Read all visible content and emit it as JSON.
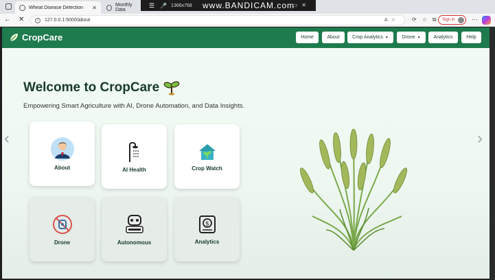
{
  "browser": {
    "tabs": [
      {
        "title": "Wheat Disease Detection",
        "active": true
      },
      {
        "title": "Monthly Data",
        "active": false
      }
    ],
    "recorder": {
      "resolution": "1366x768",
      "brand": "www.BANDICAM.com"
    },
    "url": "127.0.0.1:5000/about",
    "signin_label": "Sign in"
  },
  "navbar": {
    "brand": "CropCare",
    "items": [
      {
        "label": "Home",
        "dropdown": false
      },
      {
        "label": "About",
        "dropdown": false
      },
      {
        "label": "Crop Analytics",
        "dropdown": true
      },
      {
        "label": "Drone",
        "dropdown": true
      },
      {
        "label": "Analytics",
        "dropdown": false
      },
      {
        "label": "Help",
        "dropdown": false
      }
    ]
  },
  "hero": {
    "title": "Welcome to CropCare",
    "subtitle": "Empowering Smart Agriculture with AI, Drone Automation, and Data Insights."
  },
  "cards": [
    {
      "label": "About",
      "icon": "person-icon"
    },
    {
      "label": "AI Health",
      "icon": "shower-icon"
    },
    {
      "label": "Crop Watch",
      "icon": "house-leaf-icon"
    },
    {
      "label": "Drone",
      "icon": "drone-icon"
    },
    {
      "label": "Autonomous",
      "icon": "robot-icon"
    },
    {
      "label": "Analytics",
      "icon": "money-icon"
    }
  ],
  "colors": {
    "brand_green": "#1e7b4e",
    "title_green": "#173a2a"
  }
}
